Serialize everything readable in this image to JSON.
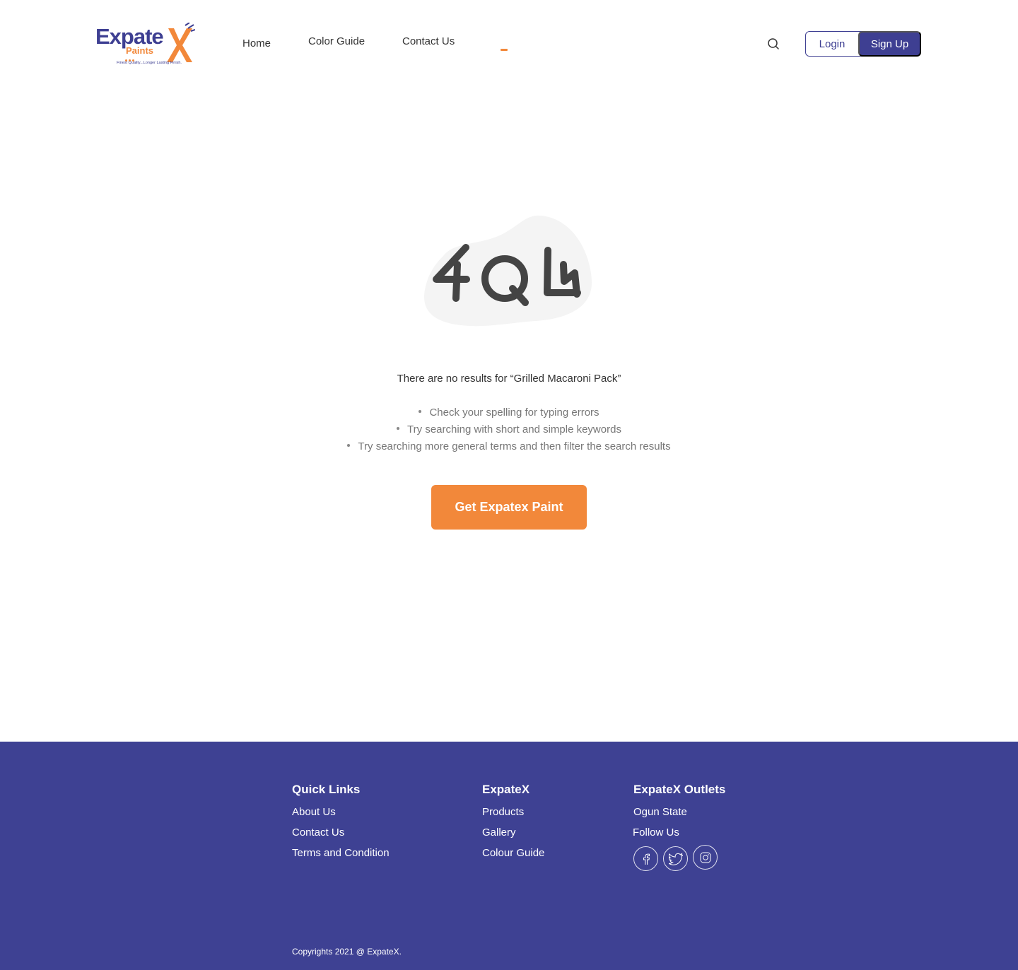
{
  "colors": {
    "brand_primary": "#3e3f92",
    "brand_accent": "#f2883a",
    "footer_bg": "#3e4193",
    "blob": "#f4f4f4",
    "digit": "#444444"
  },
  "header": {
    "logo": {
      "word": "Expate",
      "x_letter": "X",
      "sub": "Paints",
      "tagline": "Finest Quality...Longer Lasting Finish."
    },
    "nav": {
      "home": "Home",
      "color_guide": "Color Guide",
      "contact_us": "Contact Us"
    },
    "search_icon": "search-icon",
    "login_label": "Login",
    "signup_label": "Sign Up"
  },
  "main": {
    "illustration_text": "404",
    "message": "There are no results for “Grilled Macaroni Pack”",
    "tips": [
      "Check your spelling for typing errors",
      "Try searching with short and simple keywords",
      "Try searching more general terms and then filter the search results"
    ],
    "cta_label": "Get Expatex Paint"
  },
  "footer": {
    "quick_links": {
      "title": "Quick Links",
      "items": [
        "About Us",
        "Contact Us",
        "Terms and Condition"
      ]
    },
    "expatex": {
      "title": "ExpateX",
      "items": [
        "Products",
        "Gallery",
        "Colour Guide"
      ]
    },
    "outlets": {
      "title": "ExpateX Outlets",
      "items": [
        "Ogun State"
      ],
      "follow_label": "Follow Us"
    },
    "social_icons": [
      "facebook-icon",
      "twitter-icon",
      "instagram-icon"
    ],
    "copyright": "Copyrights 2021 @ ExpateX."
  }
}
